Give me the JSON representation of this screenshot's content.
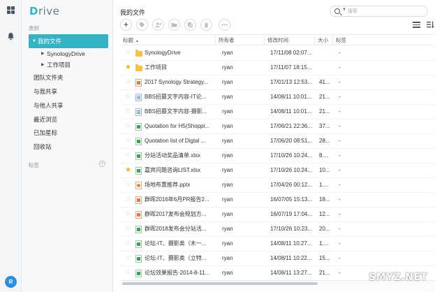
{
  "app": {
    "logo_text": "Drive",
    "avatar_letter": "R"
  },
  "sidebar": {
    "section_label": "类别",
    "my_files": "我的文件",
    "sub_items": [
      {
        "label": "SynologyDrive"
      },
      {
        "label": "工作项目"
      }
    ],
    "items": [
      {
        "label": "团队文件夹"
      },
      {
        "label": "与我共享"
      },
      {
        "label": "与他人共享"
      },
      {
        "label": "最近浏览"
      },
      {
        "label": "已加星标"
      },
      {
        "label": "回收站"
      }
    ],
    "tags_label": "标签",
    "add_tag_symbol": "+"
  },
  "header": {
    "title": "我的文件",
    "search_placeholder": "搜索"
  },
  "toolbar": {
    "new_symbol": "+",
    "icons": [
      "tag-icon",
      "share-user-icon",
      "folder-move-icon",
      "copy-icon",
      "delete-icon",
      "more-icon"
    ]
  },
  "table": {
    "columns": [
      "标题",
      "所有者",
      "修改时间",
      "大小",
      "标签"
    ],
    "rows": [
      {
        "starred": false,
        "type": "folder",
        "name": "SynologyDrive",
        "owner": "ryan",
        "modified": "17/11/08 02:07...",
        "size": "",
        "tag": "-"
      },
      {
        "starred": true,
        "type": "folder",
        "name": "工作项目",
        "owner": "ryan",
        "modified": "17/11/07 18:15...",
        "size": "",
        "tag": "-"
      },
      {
        "starred": false,
        "type": "pdfd",
        "name": "2017 Synology Strategy...",
        "owner": "ryan",
        "modified": "17/01/13 12:53...",
        "size": "41...",
        "tag": "-"
      },
      {
        "starred": false,
        "type": "doc",
        "name": "BBS招募文字内容-IT论...",
        "owner": "ryan",
        "modified": "14/08/11 10:01...",
        "size": "21...",
        "tag": "-"
      },
      {
        "starred": false,
        "type": "doc",
        "name": "BBS招募文字内容-摄影...",
        "owner": "ryan",
        "modified": "14/08/11 10:01...",
        "size": "21...",
        "tag": "-"
      },
      {
        "starred": false,
        "type": "sheet",
        "name": "Quotation for H5(Shoppi...",
        "owner": "ryan",
        "modified": "17/06/21 22:36...",
        "size": "37...",
        "tag": "-"
      },
      {
        "starred": false,
        "type": "sheet",
        "name": "Quotation list of Digtal ...",
        "owner": "ryan",
        "modified": "17/06/20 08:51...",
        "size": "28...",
        "tag": "-"
      },
      {
        "starred": false,
        "type": "sheet",
        "name": "分站活动奖品清单.xlsx",
        "owner": "ryan",
        "modified": "17/10/26 10:24...",
        "size": "8....",
        "tag": "-"
      },
      {
        "starred": true,
        "type": "sheet",
        "name": "嘉宾问题咨询LIST.xlsx",
        "owner": "ryan",
        "modified": "17/10/26 10:24...",
        "size": "10...",
        "tag": "-"
      },
      {
        "starred": false,
        "type": "slide",
        "name": "场地布置推荐.pptx",
        "owner": "ryan",
        "modified": "17/04/26 00:12...",
        "size": "1....",
        "tag": "-"
      },
      {
        "starred": false,
        "type": "pdfd",
        "name": "群晖2016年6月PR报告2...",
        "owner": "ryan",
        "modified": "16/07/05 15:13...",
        "size": "18...",
        "tag": "-"
      },
      {
        "starred": false,
        "type": "pdfd",
        "name": "群晖2017发布会规划方...",
        "owner": "ryan",
        "modified": "16/07/19 17:04...",
        "size": "12...",
        "tag": "-"
      },
      {
        "starred": false,
        "type": "sheet",
        "name": "群晖2018发布会分站活...",
        "owner": "ryan",
        "modified": "17/10/26 10:23...",
        "size": "20...",
        "tag": "-"
      },
      {
        "starred": false,
        "type": "sheet",
        "name": "论坛-IT、摄影类（木一...",
        "owner": "ryan",
        "modified": "14/08/11 10:27...",
        "size": "1....",
        "tag": "-"
      },
      {
        "starred": false,
        "type": "sheet",
        "name": "论坛-IT、摄影类（立特...",
        "owner": "ryan",
        "modified": "14/08/11 10:22...",
        "size": "15...",
        "tag": "-"
      },
      {
        "starred": false,
        "type": "sheet",
        "name": "论坛效果报告-2014-8-11...",
        "owner": "ryan",
        "modified": "14/08/11 13:27...",
        "size": "21...",
        "tag": "-"
      }
    ]
  },
  "watermark": "SMYZ.NET"
}
